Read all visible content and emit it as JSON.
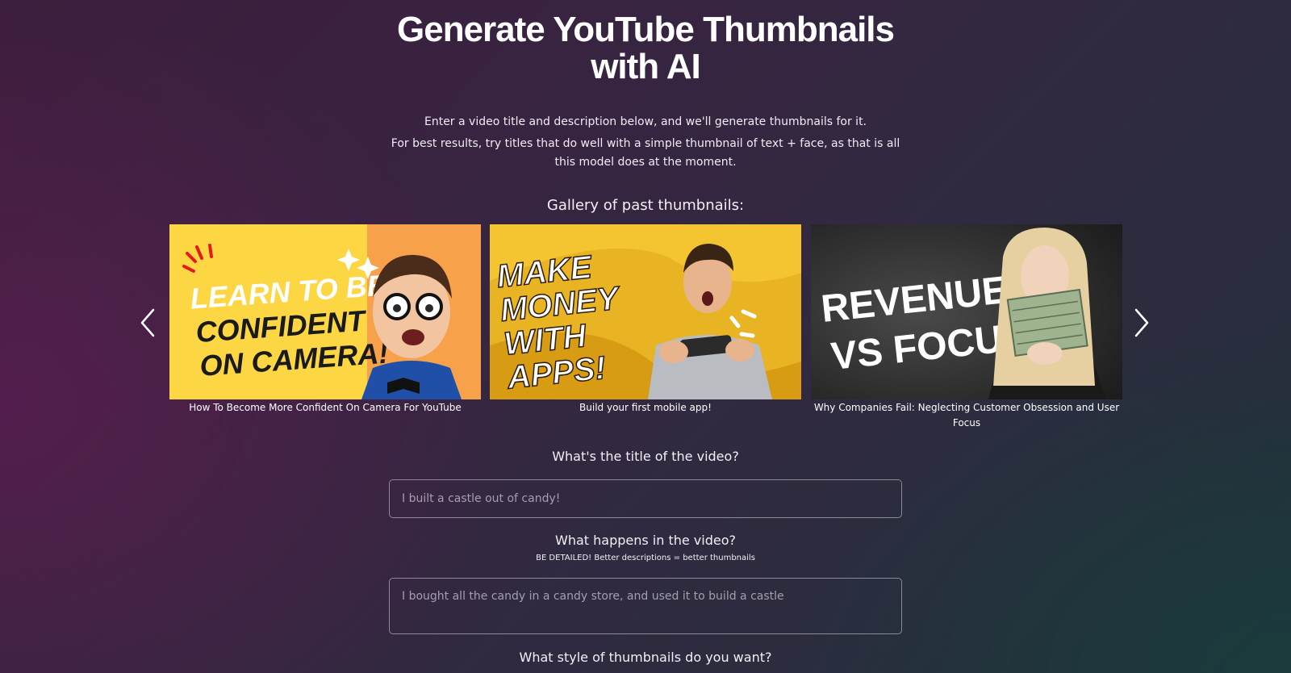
{
  "hero": {
    "title_line1": "Generate YouTube Thumbnails",
    "title_line2": "with AI",
    "intro_line1": "Enter a video title and description below, and we'll generate thumbnails for it.",
    "intro_line2": "For best results, try titles that do well with a simple thumbnail of text + face, as that is all this model does at the moment."
  },
  "gallery": {
    "heading": "Gallery of past thumbnails:",
    "prev_icon": "chevron-left-icon",
    "next_icon": "chevron-right-icon",
    "items": [
      {
        "caption": "How To Become More Confident On Camera For YouTube",
        "thumb_text": [
          "LEARN TO BE",
          "CONFIDENT",
          "ON CAMERA!"
        ],
        "colors": {
          "background": "#fdd743",
          "accent": "#f7a14a",
          "text": "#1a1a1a"
        }
      },
      {
        "caption": "Build your first mobile app!",
        "thumb_text": [
          "MAKE",
          "MONEY",
          "WITH",
          "APPS!"
        ],
        "colors": {
          "background": "#e9b423",
          "accent": "#f5c531",
          "text": "#ffffff"
        }
      },
      {
        "caption": "Why Companies Fail: Neglecting Customer Obsession and User Focus",
        "thumb_text": [
          "REVENUE",
          "VS FOCUS"
        ],
        "colors": {
          "background": "#2c2c2c",
          "accent": "#4a4a4a",
          "text": "#ffffff"
        }
      }
    ]
  },
  "form": {
    "title_label": "What's the title of the video?",
    "title_placeholder": "I built a castle out of candy!",
    "happens_label": "What happens in the video?",
    "happens_hint": "BE DETAILED! Better descriptions = better thumbnails",
    "happens_placeholder": "I bought all the candy in a candy store, and used it to build a castle",
    "style_label": "What style of thumbnails do you want?"
  }
}
